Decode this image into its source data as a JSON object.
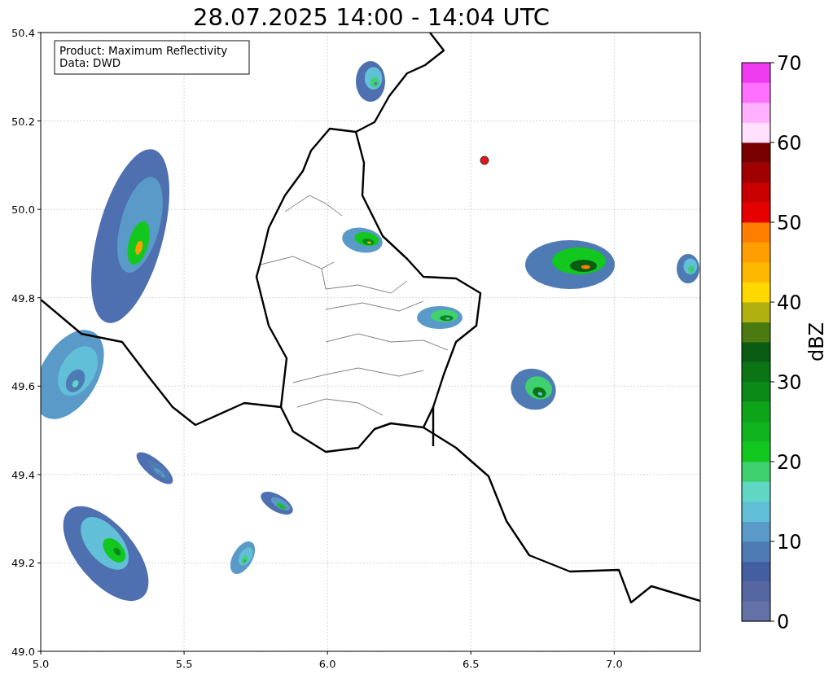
{
  "title": "28.07.2025 14:00 - 14:04 UTC",
  "legend": [
    "Product: Maximum Reflectivity",
    "Data: DWD"
  ],
  "x_axis": {
    "ticks": [
      "5.0",
      "5.5",
      "6.0",
      "6.5",
      "7.0"
    ]
  },
  "y_axis": {
    "ticks": [
      "50.4",
      "50.2",
      "50.0",
      "49.8",
      "49.6",
      "49.4",
      "49.2",
      "49.0"
    ]
  },
  "colorbar": {
    "label": "dBZ",
    "ticks": [
      "70",
      "60",
      "50",
      "40",
      "30",
      "20",
      "10",
      "0"
    ],
    "segments": [
      {
        "color": "#6272a6"
      },
      {
        "color": "#5566a0"
      },
      {
        "color": "#445fa0"
      },
      {
        "color": "#4e7bb4"
      },
      {
        "color": "#5a9ac8"
      },
      {
        "color": "#62bfd8"
      },
      {
        "color": "#60d7c4"
      },
      {
        "color": "#3fd070"
      },
      {
        "color": "#12c81e"
      },
      {
        "color": "#10b41c"
      },
      {
        "color": "#0ea41a"
      },
      {
        "color": "#0c8a18"
      },
      {
        "color": "#0b7515"
      },
      {
        "color": "#0a5c12"
      },
      {
        "color": "#4a7a10"
      },
      {
        "color": "#b0b010"
      },
      {
        "color": "#ffd800"
      },
      {
        "color": "#ffb800"
      },
      {
        "color": "#ff9e00"
      },
      {
        "color": "#ff7e00"
      },
      {
        "color": "#e60000"
      },
      {
        "color": "#c80000"
      },
      {
        "color": "#a00000"
      },
      {
        "color": "#780000"
      },
      {
        "color": "#ffe0ff"
      },
      {
        "color": "#ffb0ff"
      },
      {
        "color": "#ff70ff"
      },
      {
        "color": "#f03cf0"
      }
    ]
  }
}
